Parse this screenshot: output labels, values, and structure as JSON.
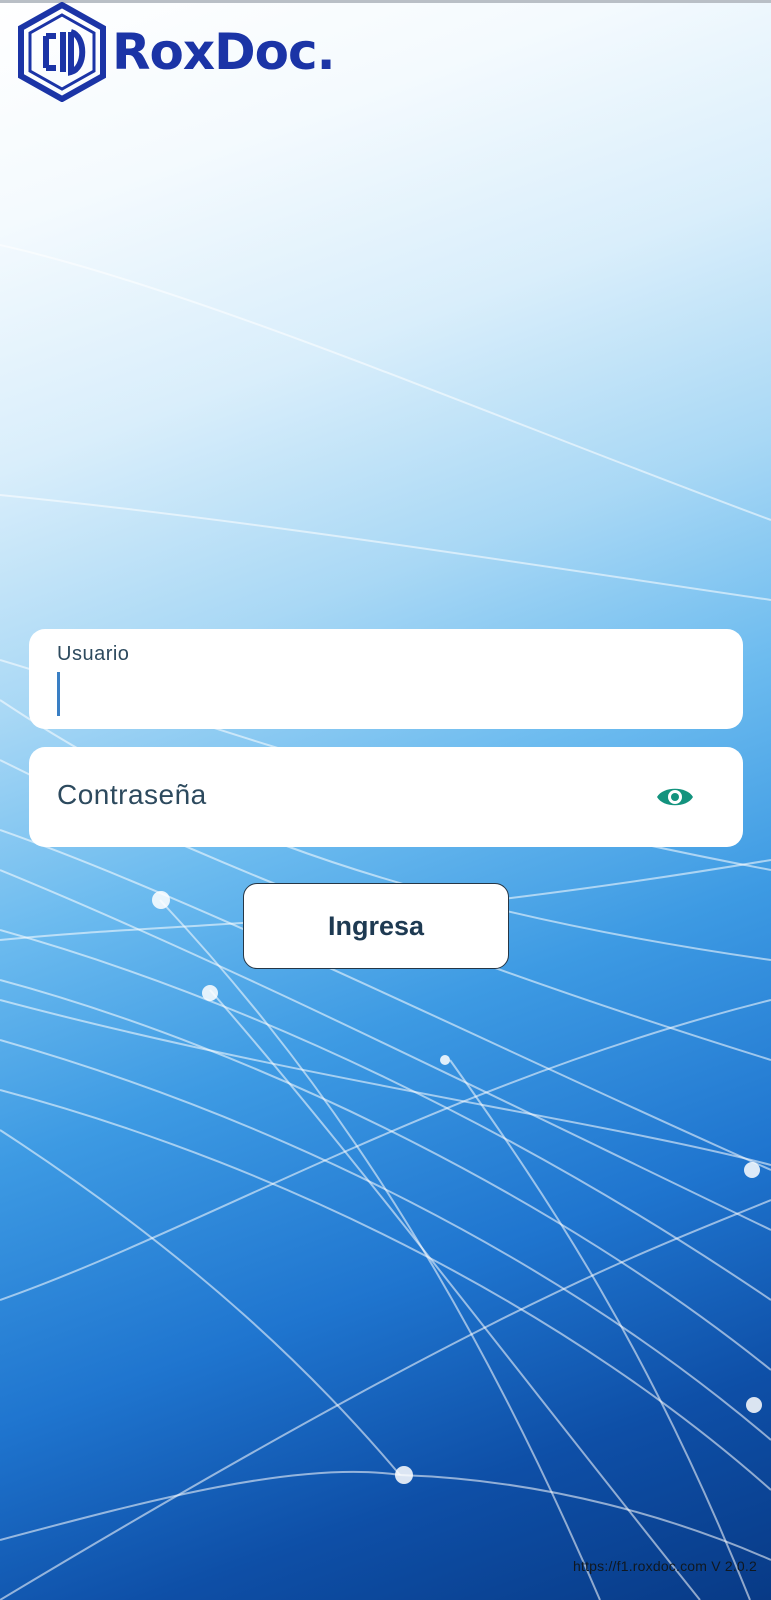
{
  "app": {
    "logo_text": "RoxDoc."
  },
  "login": {
    "username_label": "Usuario",
    "username_value": "",
    "password_placeholder": "Contraseña",
    "password_toggle_icon": "eye-icon",
    "submit_label": "Ingresa"
  },
  "footer": {
    "version_text": "https://f1.roxdoc.com V 2.0.2"
  },
  "colors": {
    "brand": "#1b34a6",
    "eye_icon": "#13937e",
    "text": "#2d4a5e"
  }
}
